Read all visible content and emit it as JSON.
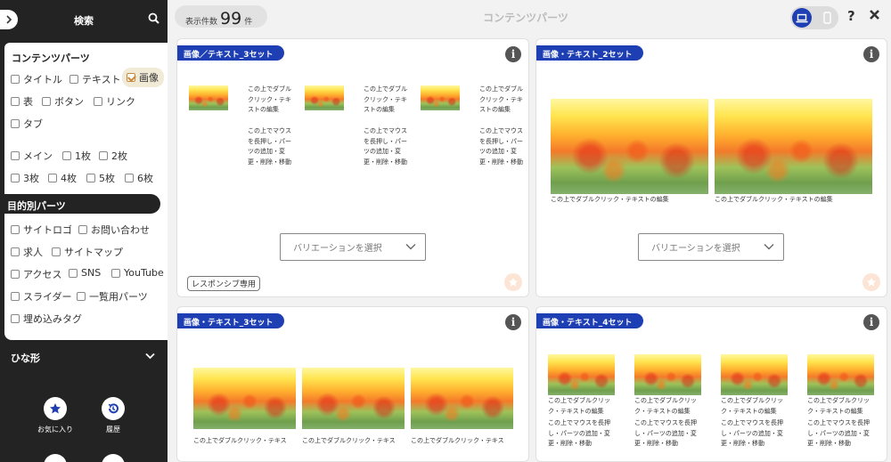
{
  "sidebar": {
    "search_title": "検索",
    "sections": {
      "contents_parts": "コンテンツパーツ",
      "purpose_parts": "目的別パーツ",
      "template": "ひな形"
    },
    "checkboxes": {
      "title": "タイトル",
      "text": "テキスト",
      "image": "画像",
      "table": "表",
      "button": "ボタン",
      "link": "リンク",
      "tab": "タブ",
      "main": "メイン",
      "one": "1枚",
      "two": "2枚",
      "three": "3枚",
      "four": "4枚",
      "five": "5枚",
      "six": "6枚",
      "site_logo": "サイトロゴ",
      "contact": "お問い合わせ",
      "recruit": "求人",
      "sitemap": "サイトマップ",
      "access": "アクセス",
      "sns": "SNS",
      "youtube": "YouTube",
      "slider": "スライダー",
      "list_parts": "一覧用パーツ",
      "embed_tag": "埋め込みタグ"
    },
    "favorites_label": "お気に入り",
    "history_label": "履歴"
  },
  "topbar": {
    "count_prefix": "表示件数",
    "count": "99",
    "count_suffix": "件",
    "page_title": "コンテンツパーツ"
  },
  "cards": [
    {
      "tag": "画像／テキスト_3セット",
      "caption_a": "この上でダブルクリック・テキストの編集",
      "caption_b": "この上でマウスを長押し・パーツの追加・変更・削除・移動",
      "select": "バリエーションを選択",
      "responsive": "レスポンシブ専用"
    },
    {
      "tag": "画像・テキスト_2セット",
      "caption": "この上でダブルクリック・テキストの編集",
      "select": "バリエーションを選択"
    },
    {
      "tag": "画像・テキスト_3セット",
      "caption": "この上でダブルクリック・テキス"
    },
    {
      "tag": "画像・テキスト_4セット",
      "caption_a": "この上でダブルクリック・テキストの編集",
      "caption_b": "この上でマウスを長押し・パーツの追加・変更・削除・移動"
    }
  ],
  "colors": {
    "sidebar_bg": "#232323",
    "accent_blue": "#1e3fb3",
    "selected_bg": "#f1ead7"
  },
  "icons": [
    "chevron-right-icon",
    "search-icon",
    "chevron-down-icon",
    "star-icon",
    "history-icon",
    "info-icon",
    "laptop-icon",
    "smartphone-icon",
    "help-icon",
    "close-icon"
  ]
}
